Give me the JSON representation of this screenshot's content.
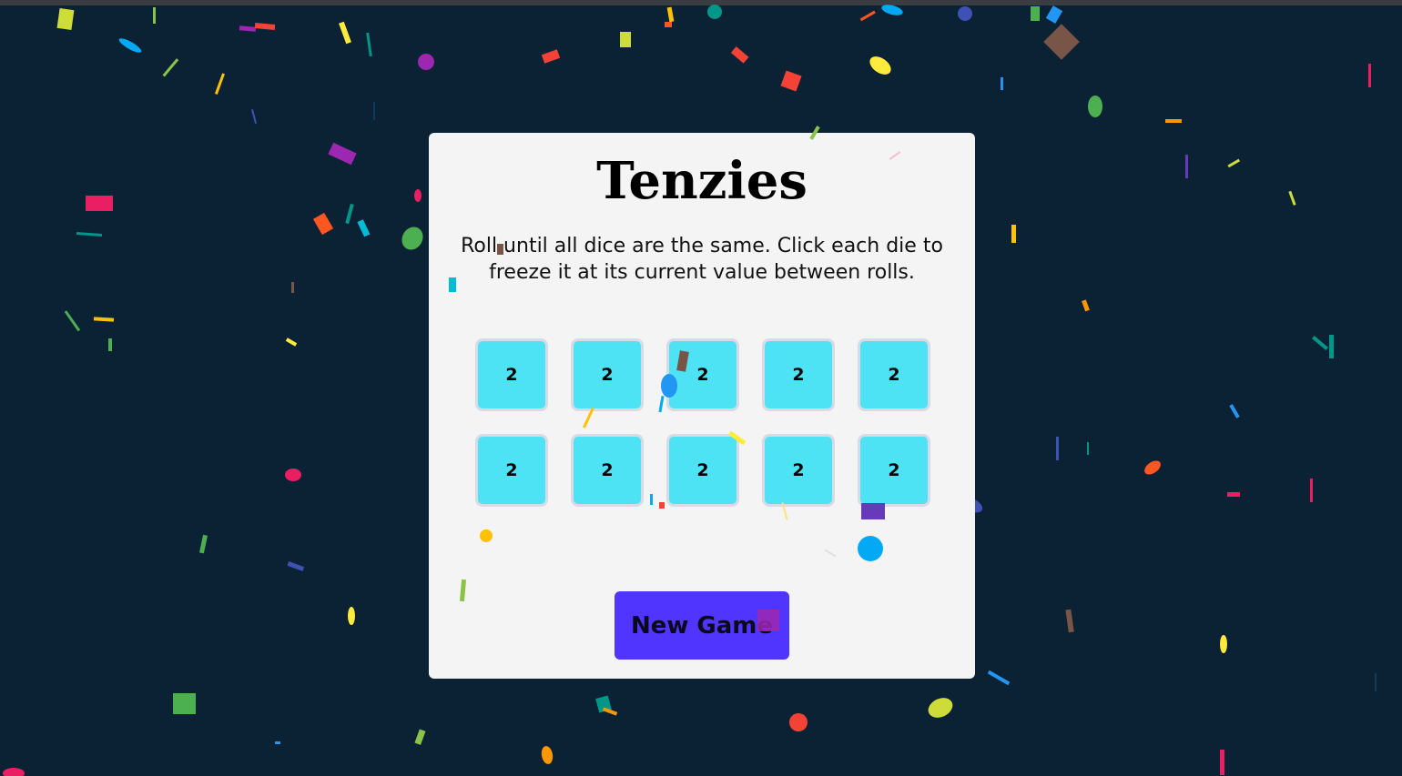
{
  "app": {
    "title": "Tenzies",
    "instructions": "Roll until all dice are the same. Click each die to freeze it at its current value between rolls."
  },
  "dice": [
    {
      "value": "2"
    },
    {
      "value": "2"
    },
    {
      "value": "2"
    },
    {
      "value": "2"
    },
    {
      "value": "2"
    },
    {
      "value": "2"
    },
    {
      "value": "2"
    },
    {
      "value": "2"
    },
    {
      "value": "2"
    },
    {
      "value": "2"
    }
  ],
  "controls": {
    "new_game_label": "New Game"
  },
  "colors": {
    "background": "#0b2234",
    "card": "#f4f4f5",
    "die": "#4ee3f4",
    "button": "#5035ff",
    "confetti_palette": [
      "#e91e63",
      "#f44336",
      "#ff5722",
      "#ff9800",
      "#ffc107",
      "#ffeb3b",
      "#cddc39",
      "#8bc34a",
      "#4caf50",
      "#009688",
      "#00bcd4",
      "#03a9f4",
      "#2196f3",
      "#3f51b5",
      "#673ab7",
      "#9c27b0",
      "#795548"
    ]
  }
}
